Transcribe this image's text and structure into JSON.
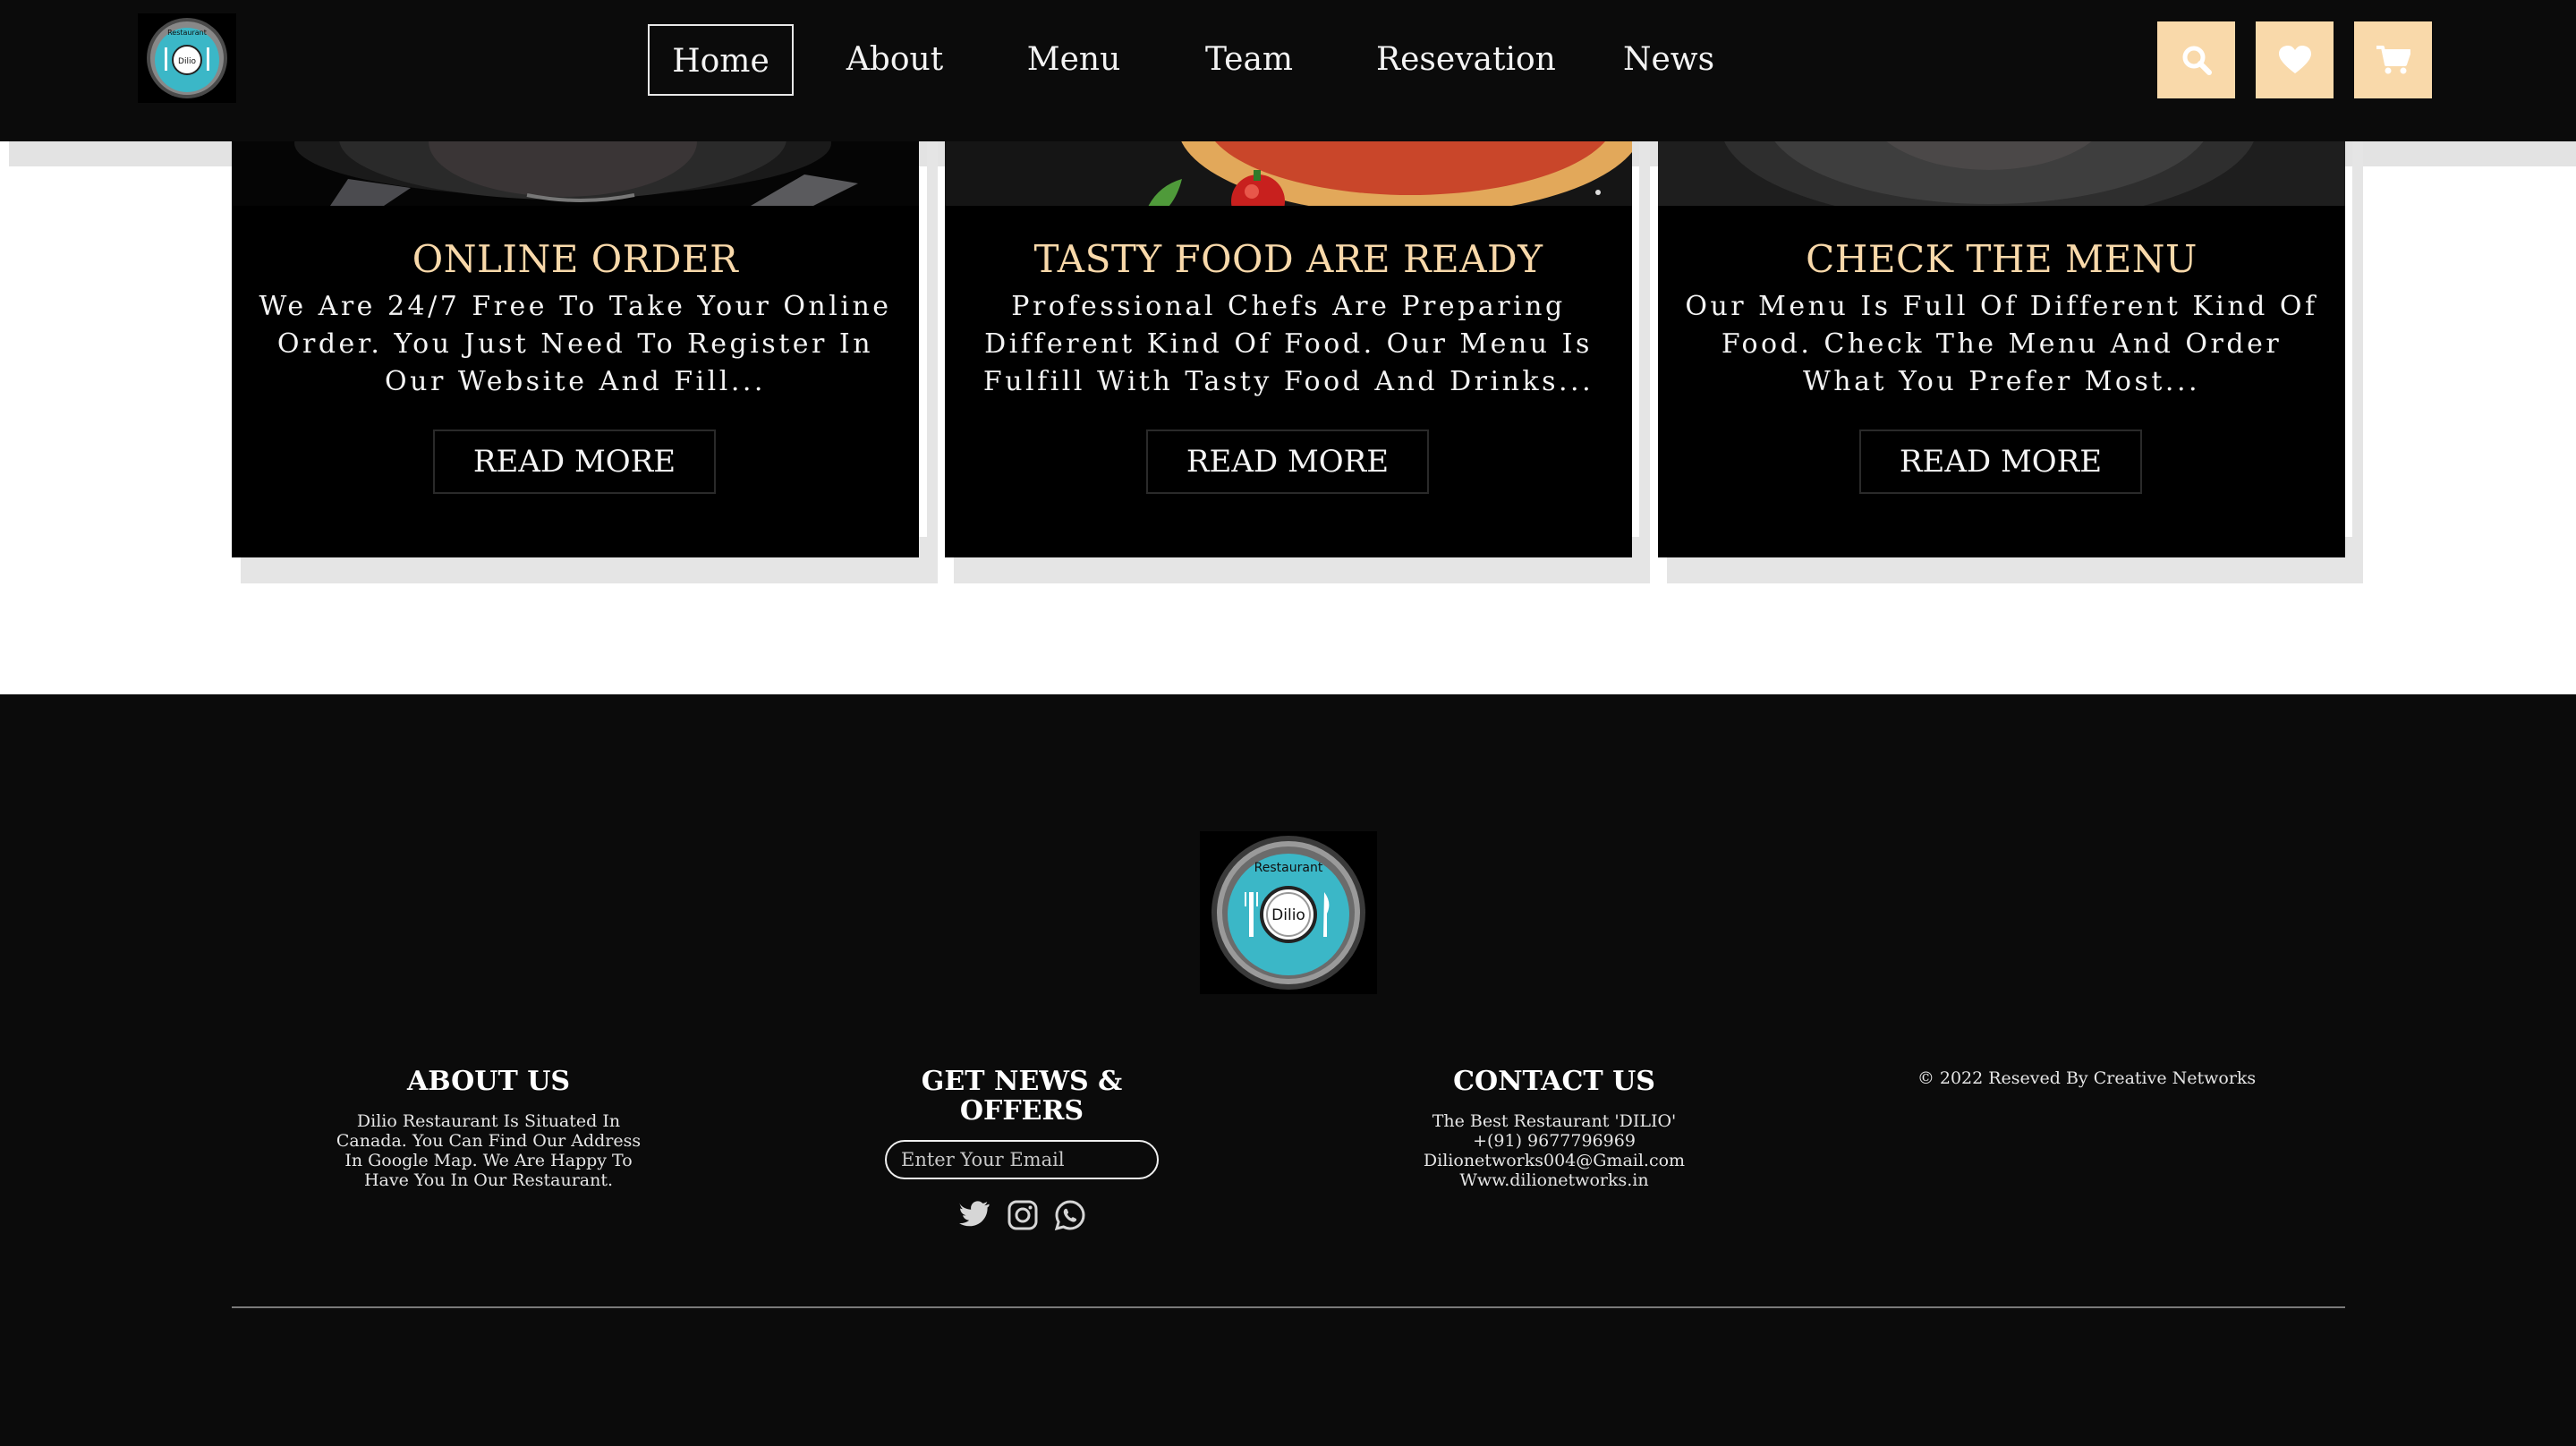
{
  "nav": {
    "items": [
      {
        "label": "Home",
        "active": true
      },
      {
        "label": "About"
      },
      {
        "label": "Menu"
      },
      {
        "label": "Team"
      },
      {
        "label": "Resevation"
      },
      {
        "label": "News"
      }
    ]
  },
  "header_buttons": {
    "search_icon": "search-icon",
    "favorite_icon": "heart-icon",
    "cart_icon": "cart-icon"
  },
  "logo": {
    "top_text": "Restaurant",
    "center_text": "Dilio"
  },
  "cards": [
    {
      "title": "ONLINE ORDER",
      "text": "We Are 24/7 Free To Take Your Online Order. You Just Need To Register In Our Website And Fill...",
      "button": "READ MORE"
    },
    {
      "title": "TASTY FOOD ARE READY",
      "text": "Professional Chefs Are Preparing Different Kind Of Food. Our Menu Is Fulfill With Tasty Food And Drinks...",
      "button": "READ MORE"
    },
    {
      "title": "CHECK THE MENU",
      "text": "Our Menu Is Full Of Different Kind Of Food. Check The Menu And Order What You Prefer Most...",
      "button": "READ MORE"
    }
  ],
  "footer": {
    "about": {
      "title": "ABOUT US",
      "lines": [
        "Dilio Restaurant Is Situated In",
        "Canada. You Can Find Our Address",
        "In Google Map. We Are Happy To",
        "Have You In Our Restaurant."
      ]
    },
    "news": {
      "title_lines": [
        "GET NEWS &",
        "OFFERS"
      ],
      "email_placeholder": "Enter Your Email",
      "social_icons": [
        "twitter-icon",
        "instagram-icon",
        "whatsapp-icon"
      ]
    },
    "contact": {
      "title": "CONTACT US",
      "lines": [
        "The Best Restaurant 'DILIO'",
        "+(91) 9677796969",
        "Dilionetworks004@Gmail.com",
        "Www.dilionetworks.in"
      ]
    },
    "copyright": "© 2022 Reseved By Creative Networks"
  },
  "colors": {
    "accent": "#f9d9aa",
    "dark": "#0b0b0b",
    "logo_teal": "#3bb7c7"
  }
}
